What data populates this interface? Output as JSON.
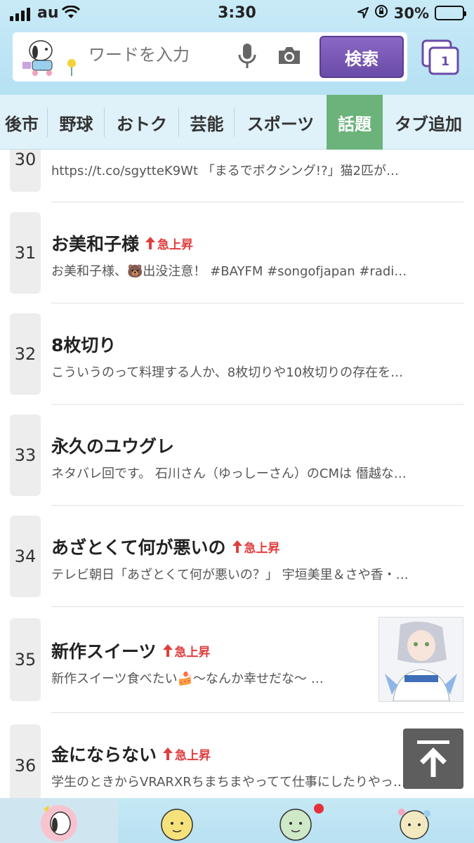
{
  "status_bar": {
    "carrier": "au",
    "time": "3:30",
    "battery": "30%",
    "battery_level": 0.3
  },
  "search": {
    "placeholder": "ワードを入力",
    "button_label": "検索",
    "tab_count": "1"
  },
  "categories": [
    {
      "label": "後市"
    },
    {
      "label": "野球"
    },
    {
      "label": "おトク"
    },
    {
      "label": "芸能"
    },
    {
      "label": "スポーツ"
    },
    {
      "label": "話題",
      "active": true
    },
    {
      "label": "タブ追加"
    }
  ],
  "badge_label": "急上昇",
  "items": [
    {
      "rank": "30",
      "title": "",
      "snippet": "https://t.co/sgytteK9Wt 「まるでボクシング!?」猫2匹が…",
      "rising": false
    },
    {
      "rank": "31",
      "title": "お美和子様",
      "snippet": "お美和子様、🐻出没注意！ #BAYFM #songofjapan #radi…",
      "rising": true
    },
    {
      "rank": "32",
      "title": "8枚切り",
      "snippet": "こういうのって料理する人か、8枚切りや10枚切りの存在を…",
      "rising": false
    },
    {
      "rank": "33",
      "title": "永久のユウグレ",
      "snippet": "ネタバレ回です。 石川さん（ゆっしーさん）のCMは 僭越な…",
      "rising": false
    },
    {
      "rank": "34",
      "title": "あざとくて何が悪いの",
      "snippet": "テレビ朝日「あざとくて何が悪いの？」 宇垣美里＆さや香・…",
      "rising": true
    },
    {
      "rank": "35",
      "title": "新作スイーツ",
      "snippet": "新作スイーツ食べたい🍰〜なんか幸せだな〜 …",
      "rising": true,
      "thumbnail": true
    },
    {
      "rank": "36",
      "title": "金にならない",
      "snippet": "学生のときからVRARXRちまちまやってて仕事にしたりやっ…",
      "rising": true
    }
  ]
}
